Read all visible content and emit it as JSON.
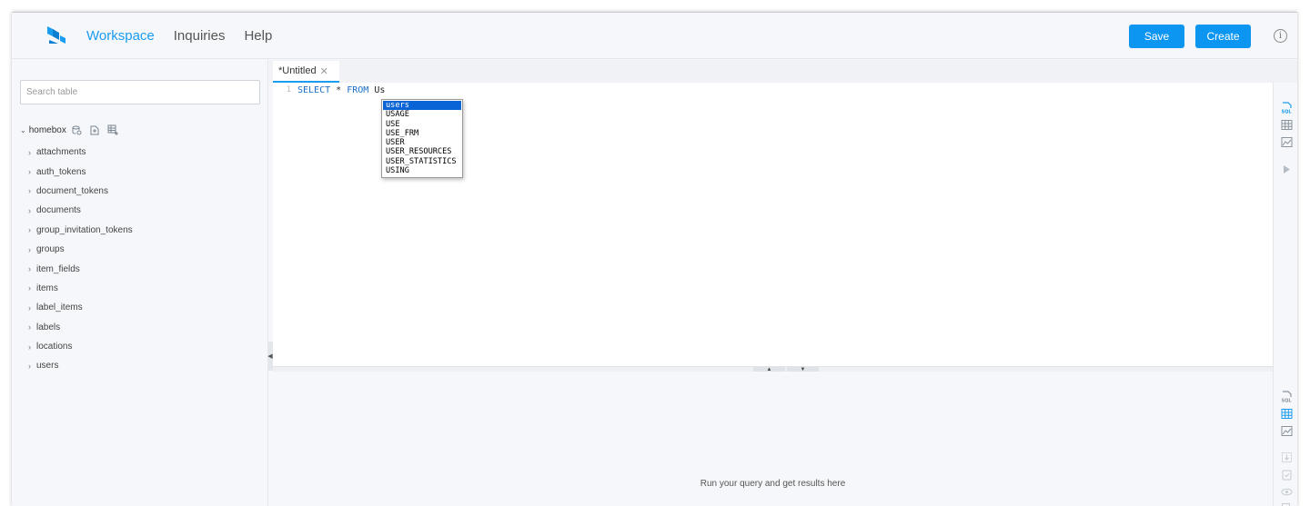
{
  "header": {
    "nav": [
      "Workspace",
      "Inquiries",
      "Help"
    ],
    "save_label": "Save",
    "create_label": "Create",
    "info_glyph": "i",
    "accent": "#0d95f2"
  },
  "sidebar": {
    "search_placeholder": "Search table",
    "database": "homebox",
    "tables": [
      "attachments",
      "auth_tokens",
      "document_tokens",
      "documents",
      "group_invitation_tokens",
      "groups",
      "item_fields",
      "items",
      "label_items",
      "labels",
      "locations",
      "users"
    ]
  },
  "editor": {
    "tab_label": "*Untitled",
    "line_number": "1",
    "code": {
      "kw1": "SELECT",
      "op": "*",
      "kw2": "FROM",
      "ident": "Us"
    },
    "autocomplete": [
      "users",
      "USAGE",
      "USE",
      "USE_FRM",
      "USER",
      "USER_RESOURCES",
      "USER_STATISTICS",
      "USING"
    ],
    "autocomplete_selected": 0
  },
  "results": {
    "message": "Run your query and get results here"
  }
}
